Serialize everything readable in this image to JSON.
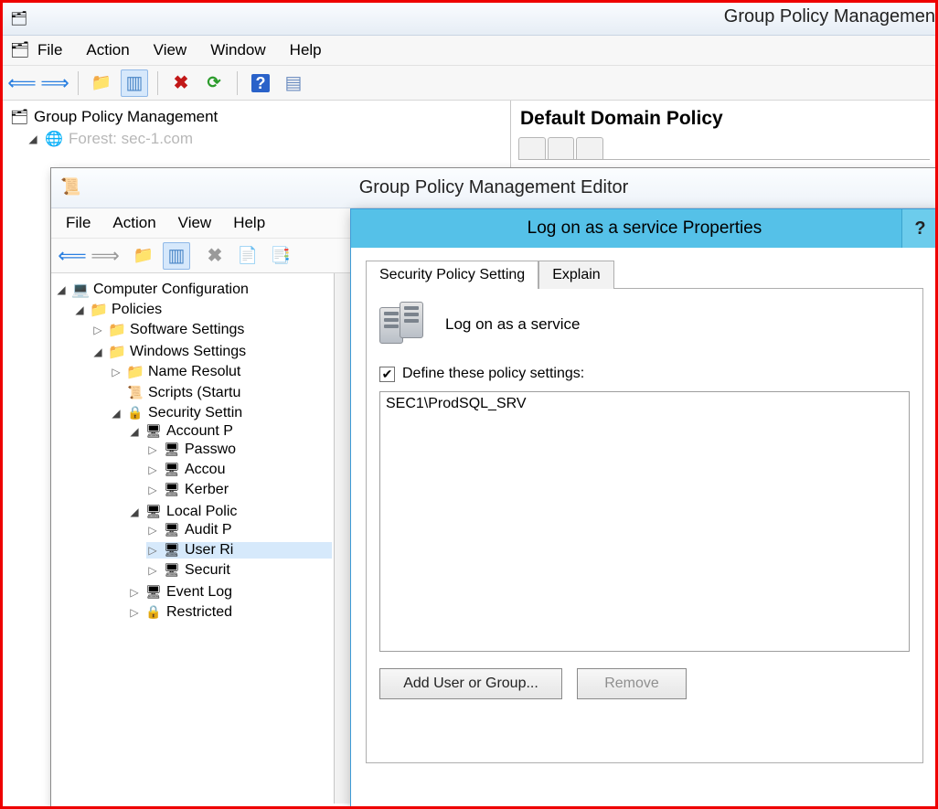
{
  "gpm": {
    "app_title": "Group Policy Managemen",
    "menu": {
      "file": "File",
      "action": "Action",
      "view": "View",
      "window": "Window",
      "help": "Help"
    },
    "tree": {
      "root": "Group Policy Management",
      "forest": "Forest: sec-1.com"
    },
    "right": {
      "title": "Default Domain Policy"
    }
  },
  "gpme": {
    "title": "Group Policy Management Editor",
    "menu": {
      "file": "File",
      "action": "Action",
      "view": "View",
      "help": "Help"
    },
    "tree": {
      "root": "Computer Configuration",
      "policies": "Policies",
      "software": "Software Settings",
      "windows": "Windows Settings",
      "nameres": "Name Resolut",
      "scripts": "Scripts (Startu",
      "security": "Security Settin",
      "account": "Account P",
      "password": "Passwo",
      "accountlk": "Accou",
      "kerberos": "Kerber",
      "local": "Local Polic",
      "audit": "Audit P",
      "userri": "User Ri",
      "secopt": "Securit",
      "eventlog": "Event Log",
      "restricted": "Restricted"
    }
  },
  "prop": {
    "title": "Log on as a service Properties",
    "help": "?",
    "tabs": {
      "setting": "Security Policy Setting",
      "explain": "Explain"
    },
    "policy_name": "Log on as a service",
    "define_label": "Define these policy settings:",
    "list": [
      "SEC1\\ProdSQL_SRV"
    ],
    "add_btn": "Add User or Group...",
    "remove_btn": "Remove"
  }
}
